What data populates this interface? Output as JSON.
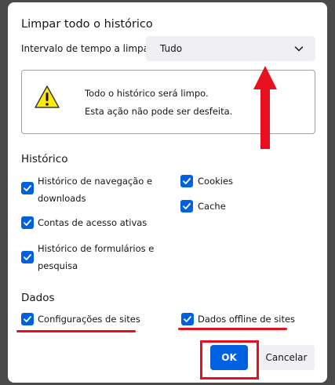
{
  "dialog": {
    "title": "Limpar todo o histórico",
    "range_label": "Intervalo de tempo a limpar:",
    "range_value": "Tudo",
    "warning_line1": "Todo o histórico será limpo.",
    "warning_line2": "Esta ação não pode ser desfeita."
  },
  "history": {
    "heading": "Histórico",
    "items": [
      {
        "label_line1": "Histórico de navegação e",
        "label_line2": "downloads",
        "checked": true
      },
      {
        "label_line1": "Contas de acesso ativas",
        "label_line2": "",
        "checked": true
      },
      {
        "label_line1": "Histórico de formulários e",
        "label_line2": "pesquisa",
        "checked": true
      },
      {
        "label_line1": "Cookies",
        "label_line2": "",
        "checked": true
      },
      {
        "label_line1": "Cache",
        "label_line2": "",
        "checked": true
      }
    ]
  },
  "data_section": {
    "heading": "Dados",
    "items": [
      {
        "label": "Configurações de sites",
        "checked": true
      },
      {
        "label": "Dados offline de sites",
        "checked": true
      }
    ]
  },
  "buttons": {
    "ok": "OK",
    "cancel": "Cancelar"
  },
  "colors": {
    "accent": "#0061e0",
    "annotation": "#e8101e",
    "warning": "#ffe900"
  }
}
